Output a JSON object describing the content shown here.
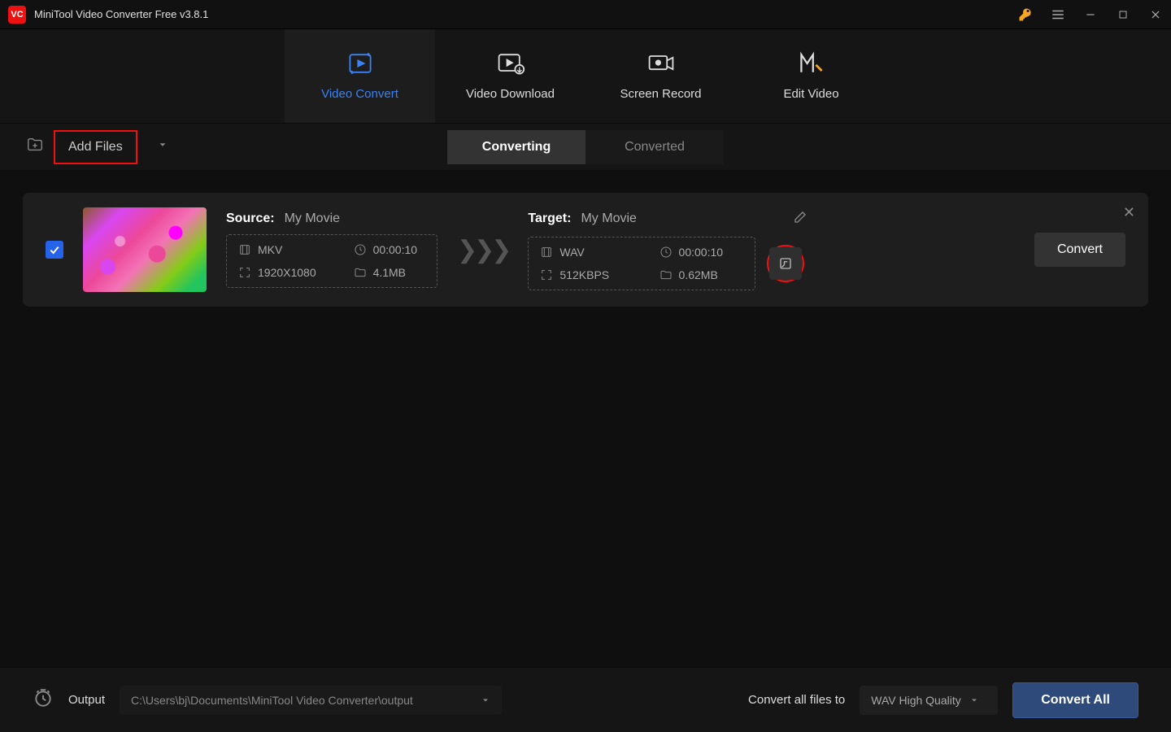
{
  "titlebar": {
    "title": "MiniTool Video Converter Free v3.8.1"
  },
  "mainTabs": {
    "convert": "Video Convert",
    "download": "Video Download",
    "record": "Screen Record",
    "edit": "Edit Video"
  },
  "toolbar": {
    "addFiles": "Add Files"
  },
  "subTabs": {
    "converting": "Converting",
    "converted": "Converted"
  },
  "file": {
    "sourceLabel": "Source:",
    "sourceName": "My Movie",
    "source": {
      "format": "MKV",
      "duration": "00:00:10",
      "resolution": "1920X1080",
      "size": "4.1MB"
    },
    "targetLabel": "Target:",
    "targetName": "My Movie",
    "target": {
      "format": "WAV",
      "duration": "00:00:10",
      "bitrate": "512KBPS",
      "size": "0.62MB"
    },
    "convertBtn": "Convert"
  },
  "footer": {
    "outputLabel": "Output",
    "outputPath": "C:\\Users\\bj\\Documents\\MiniTool Video Converter\\output",
    "convertAllLabel": "Convert all files to",
    "format": "WAV High Quality",
    "convertAll": "Convert All"
  }
}
